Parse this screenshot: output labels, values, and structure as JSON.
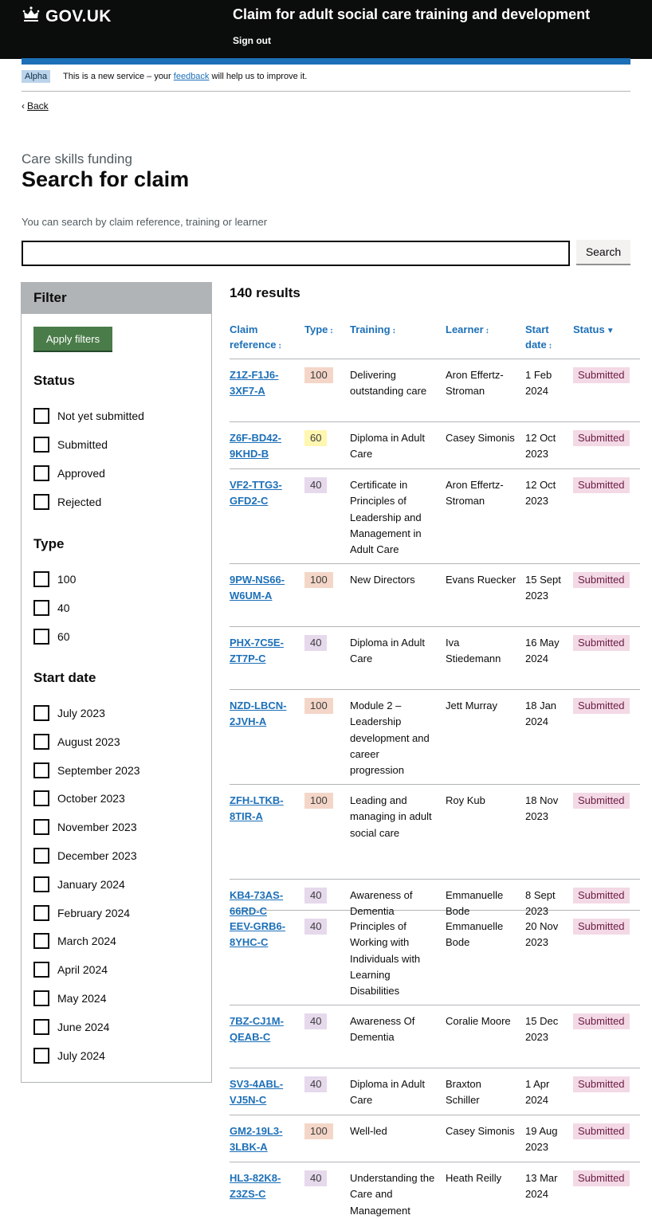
{
  "header": {
    "logo_text": "GOV.UK",
    "service_name": "Claim for adult social care training and development",
    "sign_out": "Sign out"
  },
  "phase_banner": {
    "tag": "Alpha",
    "text_before": "This is a new service – your ",
    "link": "feedback",
    "text_after": " will help us to improve it."
  },
  "back_link": "Back",
  "page": {
    "caption": "Care skills funding",
    "title": "Search for claim",
    "hint": "You can search by claim reference, training or learner",
    "search_value": "",
    "search_button": "Search"
  },
  "filter": {
    "title": "Filter",
    "apply_button": "Apply filters",
    "status_heading": "Status",
    "status_options": [
      "Not yet submitted",
      "Submitted",
      "Approved",
      "Rejected"
    ],
    "type_heading": "Type",
    "type_options": [
      "100",
      "40",
      "60"
    ],
    "date_heading": "Start date",
    "date_options": [
      "July 2023",
      "August 2023",
      "September 2023",
      "October 2023",
      "November 2023",
      "December 2023",
      "January 2024",
      "February 2024",
      "March 2024",
      "April 2024",
      "May 2024",
      "June 2024",
      "July 2024"
    ]
  },
  "results": {
    "count_label": "140 results",
    "columns": {
      "reference": "Claim reference",
      "type": "Type",
      "training": "Training",
      "learner": "Learner",
      "start_date": "Start date",
      "status": "Status",
      "sort_icon": "↕",
      "sorted_icon": "▼"
    },
    "rows": [
      {
        "ref": "Z1Z-F1J6-3XF7-A",
        "type": "100",
        "training": "Delivering outstanding care",
        "learner": "Aron Effertz-Stroman",
        "date": "1 Feb 2024",
        "status": "Submitted"
      },
      {
        "ref": "Z6F-BD42-9KHD-B",
        "type": "60",
        "training": "Diploma in Adult Care",
        "learner": "Casey Simonis",
        "date": "12 Oct 2023",
        "status": "Submitted"
      },
      {
        "ref": "VF2-TTG3-GFD2-C",
        "type": "40",
        "training": "Certificate in Principles of Leadership and Management in Adult Care",
        "learner": "Aron Effertz-Stroman",
        "date": "12 Oct 2023",
        "status": "Submitted"
      },
      {
        "ref": "9PW-NS66-W6UM-A",
        "type": "100",
        "training": "New Directors",
        "learner": "Evans Ruecker",
        "date": "15 Sept 2023",
        "status": "Submitted"
      },
      {
        "ref": "PHX-7C5E-ZT7P-C",
        "type": "40",
        "training": "Diploma in Adult Care",
        "learner": "Iva Stiedemann",
        "date": "16 May 2024",
        "status": "Submitted"
      },
      {
        "ref": "NZD-LBCN-2JVH-A",
        "type": "100",
        "training": "Module 2 – Leadership development and career progression",
        "learner": "Jett Murray",
        "date": "18 Jan 2024",
        "status": "Submitted"
      },
      {
        "ref": "ZFH-LTKB-8TIR-A",
        "type": "100",
        "training": "Leading and managing in adult social care",
        "learner": "Roy Kub",
        "date": "18 Nov 2023",
        "status": "Submitted"
      },
      {
        "ref": "KB4-73AS-66RD-C",
        "type": "40",
        "training": "Awareness of Dementia",
        "learner": "Emmanuelle Bode",
        "date": "8 Sept 2023",
        "status": "Submitted"
      },
      {
        "ref": "EEV-GRB6-8YHC-C",
        "type": "40",
        "training": "Principles of Working with Individuals with Learning Disabilities",
        "learner": "Emmanuelle Bode",
        "date": "20 Nov 2023",
        "status": "Submitted"
      },
      {
        "ref": "7BZ-CJ1M-QEAB-C",
        "type": "40",
        "training": "Awareness Of Dementia",
        "learner": "Coralie Moore",
        "date": "15 Dec 2023",
        "status": "Submitted"
      },
      {
        "ref": "SV3-4ABL-VJ5N-C",
        "type": "40",
        "training": "Diploma in Adult Care",
        "learner": "Braxton Schiller",
        "date": "1 Apr 2024",
        "status": "Submitted"
      },
      {
        "ref": "GM2-19L3-3LBK-A",
        "type": "100",
        "training": "Well-led",
        "learner": "Casey Simonis",
        "date": "19 Aug 2023",
        "status": "Submitted"
      },
      {
        "ref": "HL3-82K8-Z3ZS-C",
        "type": "40",
        "training": "Understanding the Care and Management",
        "learner": "Heath Reilly",
        "date": "13 Mar 2024",
        "status": "Submitted"
      }
    ]
  }
}
